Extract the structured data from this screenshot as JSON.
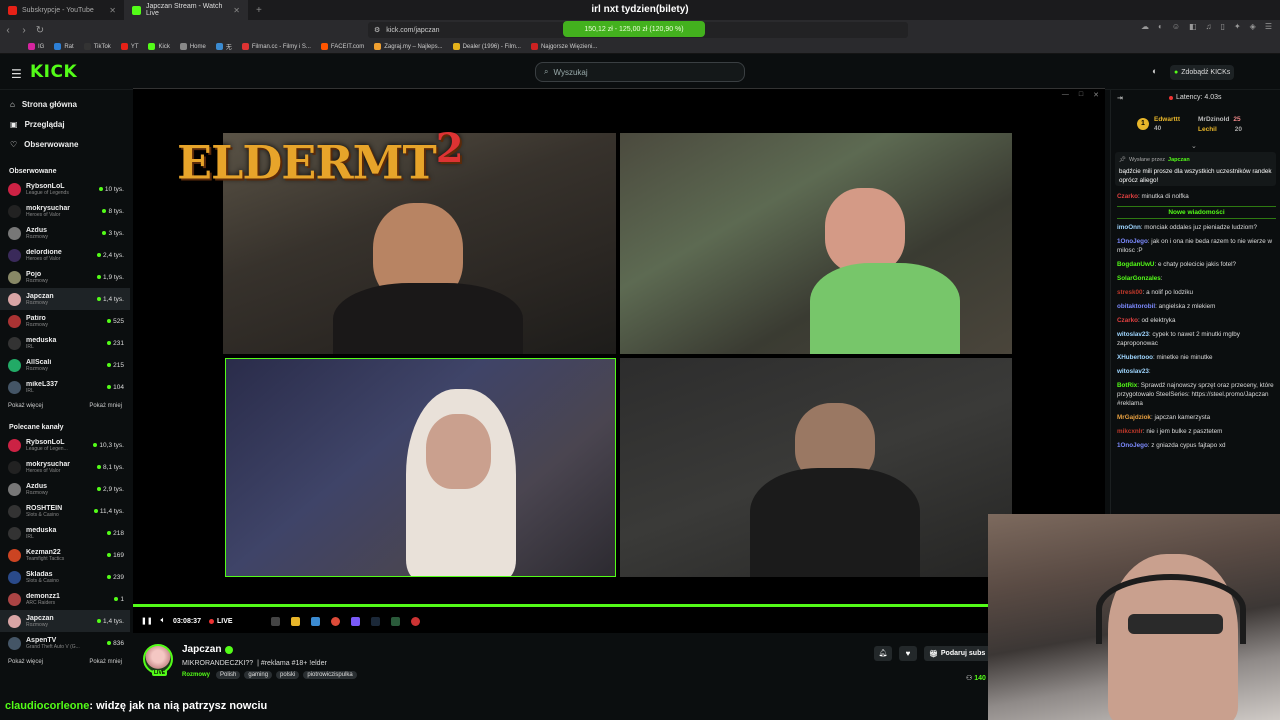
{
  "browser": {
    "tabs": [
      {
        "title": "Subskrypcje - YouTube",
        "favicon_color": "#e62117",
        "active": false
      },
      {
        "title": "Japczan Stream - Watch Live",
        "favicon_color": "#53fc18",
        "active": true
      }
    ],
    "page_title": "irl nxt tydzien(bilety)",
    "url": "kick.com/japczan",
    "price_badge": "150,12 zł - 125,00 zł (120,90 %)",
    "bookmarks": [
      {
        "label": "IG",
        "color": "#d6249f"
      },
      {
        "label": "Rat",
        "color": "#2c7fd6"
      },
      {
        "label": "TikTok",
        "color": "#333"
      },
      {
        "label": "YT",
        "color": "#e62117"
      },
      {
        "label": "Kick",
        "color": "#53fc18"
      },
      {
        "label": "Home",
        "color": "#888"
      },
      {
        "label": "无",
        "color": "#3b8bd1"
      },
      {
        "label": "Filman.cc - Filmy i S...",
        "color": "#d33"
      },
      {
        "label": "FACEIT.com",
        "color": "#ff5500"
      },
      {
        "label": "Zagraj.my – Najleps...",
        "color": "#f0a030"
      },
      {
        "label": "Dealer (1996) - Film...",
        "color": "#e4b21b"
      },
      {
        "label": "Najgorsze Więzieni...",
        "color": "#c22"
      }
    ]
  },
  "kick": {
    "logo": "KICK",
    "search_placeholder": "Wyszukaj",
    "get_kicks": "Zdobądź KICKs",
    "nav": [
      {
        "label": "Strona główna",
        "icon": "home-icon"
      },
      {
        "label": "Przeglądaj",
        "icon": "browse-icon"
      },
      {
        "label": "Obserwowane",
        "icon": "heart-icon"
      }
    ],
    "followed_header": "Obserwowane",
    "followed": [
      {
        "name": "RybsonLoL",
        "cat": "League of Legends",
        "viewers": "10 tys.",
        "color": "#c24"
      },
      {
        "name": "mokrysuchar",
        "cat": "Heroes of Valor",
        "viewers": "8 tys.",
        "color": "#222"
      },
      {
        "name": "Azdus",
        "cat": "Rozmowy",
        "viewers": "3 tys.",
        "color": "#777"
      },
      {
        "name": "delordione",
        "cat": "Heroes of Valor",
        "viewers": "2,4 tys.",
        "color": "#3a2a5a"
      },
      {
        "name": "Pojo",
        "cat": "Rozmowy",
        "viewers": "1,9 tys.",
        "color": "#886"
      },
      {
        "name": "Japczan",
        "cat": "Rozmowy",
        "viewers": "1,4 tys.",
        "color": "#d9a5a5",
        "selected": true
      },
      {
        "name": "Patiro",
        "cat": "Rozmowy",
        "viewers": "525",
        "color": "#a33"
      },
      {
        "name": "meduska",
        "cat": "IRL",
        "viewers": "231",
        "color": "#333"
      },
      {
        "name": "AllScali",
        "cat": "Rozmowy",
        "viewers": "215",
        "color": "#2a6"
      },
      {
        "name": "mikeL337",
        "cat": "IRL",
        "viewers": "104",
        "color": "#456"
      }
    ],
    "show_more": "Pokaż więcej",
    "show_less": "Pokaż mniej",
    "recommended_header": "Polecane kanały",
    "recommended": [
      {
        "name": "RybsonLoL",
        "cat": "League of Legen...",
        "viewers": "10,3 tys.",
        "color": "#c24"
      },
      {
        "name": "mokrysuchar",
        "cat": "Heroes of Valor",
        "viewers": "8,1 tys.",
        "color": "#222"
      },
      {
        "name": "Azdus",
        "cat": "Rozmowy",
        "viewers": "2,9 tys.",
        "color": "#777"
      },
      {
        "name": "ROSHTEIN",
        "cat": "Slots & Casino",
        "viewers": "11,4 tys.",
        "color": "#333"
      },
      {
        "name": "meduska",
        "cat": "IRL",
        "viewers": "218",
        "color": "#333"
      },
      {
        "name": "Kezman22",
        "cat": "Teamfight Tactics",
        "viewers": "169",
        "color": "#c42"
      },
      {
        "name": "Skladas",
        "cat": "Slots & Casino",
        "viewers": "239",
        "color": "#2a4a8a"
      },
      {
        "name": "demonzz1",
        "cat": "ARC Raiders",
        "viewers": "1",
        "color": "#a44"
      },
      {
        "name": "Japczan",
        "cat": "Rozmowy",
        "viewers": "1,4 tys.",
        "color": "#d9a5a5",
        "selected": true
      },
      {
        "name": "AspenTV",
        "cat": "Grand Theft Auto V (G...",
        "viewers": "836",
        "color": "#456"
      }
    ]
  },
  "player": {
    "overlay_logo": "ELDERMT",
    "overlay_logo_suffix": "2",
    "time": "03:08:37",
    "live": "LIVE",
    "progress_fraction": 0.88
  },
  "stream": {
    "streamer": "Japczan",
    "live_badge": "LIVE",
    "title": "MIKRORANDECZKI?? ︎ | #reklama #18+ !elder",
    "category": "Rozmowy",
    "tags": [
      "Polish",
      "gaming",
      "polski",
      "piotrowiczispulka"
    ],
    "gift_label": "Podaruj subs",
    "viewers": "140"
  },
  "caption": {
    "user": "claudiocorleone",
    "text": ": widzę jak na nią patrzysz nowciu"
  },
  "chat": {
    "latency": "Latency: 4.03s",
    "leaderboard": [
      {
        "name": "Edwarttt",
        "value": "40",
        "color": "#e8b62a"
      },
      {
        "name": "MrDzinold",
        "value": "25",
        "color": "#bbb"
      },
      {
        "name": "Lechil",
        "value": "20",
        "color": "#e8b62a"
      }
    ],
    "pinned_by": "Wysłane przez",
    "pinned_user": "Japczan",
    "pinned_text": "bądźcie mili prosze dla wszystkich uczestników randek oprócz aliego!",
    "new_messages": "Nowe wiadomości",
    "messages_top": [
      {
        "user": "Czarko",
        "color": "#e04040",
        "text": "minutka di nolfka"
      }
    ],
    "messages": [
      {
        "user": "imoOnn",
        "color": "#9fd6ff",
        "text": "monciak oddales juz pieniadze ludziom?"
      },
      {
        "user": "1OnoJego",
        "color": "#7d8bff",
        "text": "jak on i ona nie beda razem to nie wierze w milosc :P"
      },
      {
        "user": "BogdanUwU",
        "color": "#53fc18",
        "text": "e chaty polecicie jakis fotel?"
      },
      {
        "user": "SolarGonzales",
        "color": "#53fc18",
        "text": ""
      },
      {
        "user": "stresk00",
        "color": "#c0392b",
        "text": "a nolif po lodziku"
      },
      {
        "user": "obitaktorobil",
        "color": "#7d8bff",
        "text": "angielska z mlekiem"
      },
      {
        "user": "Czarko",
        "color": "#e04040",
        "text": "od elektryka"
      },
      {
        "user": "witoslav23",
        "color": "#9fd6ff",
        "text": "cypek to nawet 2 minutki mglby zaproponowac"
      },
      {
        "user": "XHubertooo",
        "color": "#9fd6ff",
        "text": "minetke nie minutke"
      },
      {
        "user": "witoslav23",
        "color": "#9fd6ff",
        "text": ""
      },
      {
        "user": "BotRix",
        "color": "#53fc18",
        "text": "Sprawdź najnowszy sprzęt oraz przeceny, które przygotowało SteelSeries: https://steel.promo/Japczan #reklama"
      },
      {
        "user": "MrGajdziok",
        "color": "#e8a040",
        "text": "japczan kamerzysta"
      },
      {
        "user": "mikcxnlr",
        "color": "#c0392b",
        "text": "nie i jem bulke z pasztetem"
      },
      {
        "user": "1OnoJego",
        "color": "#7d8bff",
        "text": "z gniazda cypus fajtapo xd"
      }
    ]
  }
}
